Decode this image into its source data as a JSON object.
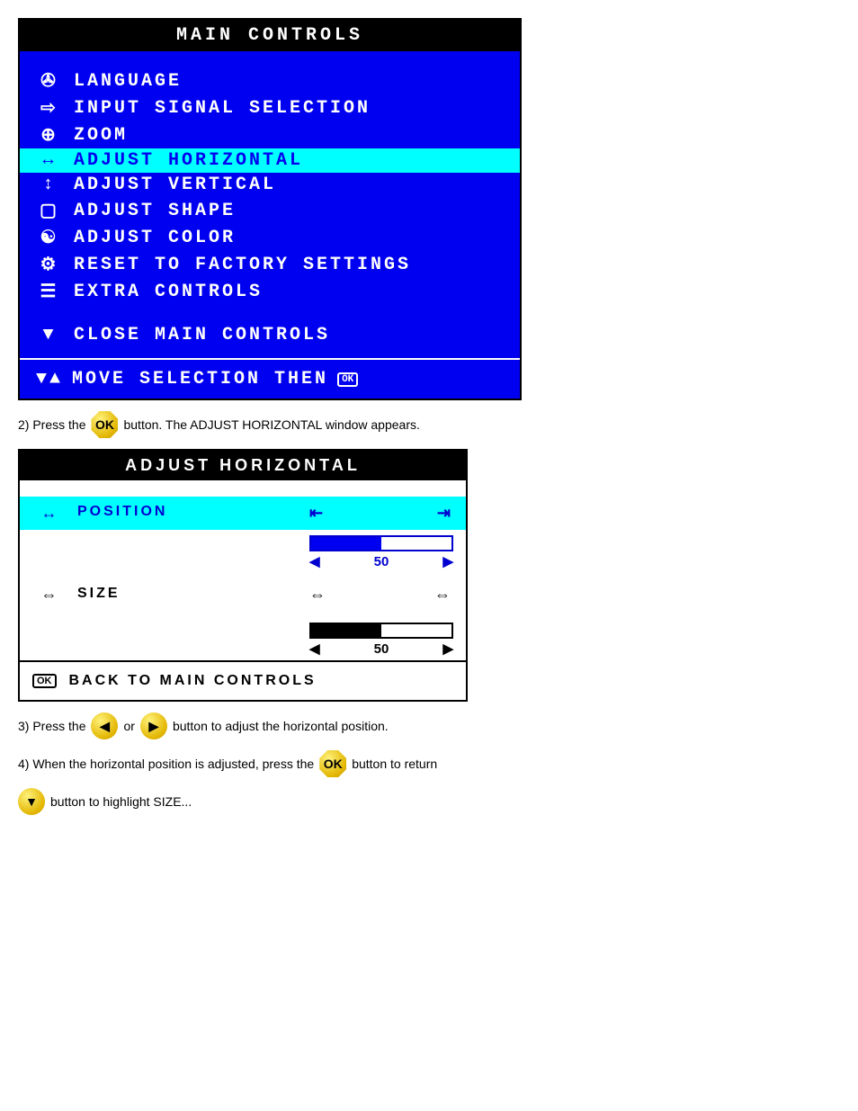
{
  "main_osd": {
    "title": "MAIN CONTROLS",
    "items": [
      {
        "icon": "language-icon",
        "glyph": "✇",
        "label": "LANGUAGE"
      },
      {
        "icon": "input-icon",
        "glyph": "⇨",
        "label": "INPUT SIGNAL SELECTION"
      },
      {
        "icon": "zoom-icon",
        "glyph": "⊕",
        "label": "ZOOM"
      },
      {
        "icon": "horiz-icon",
        "glyph": "↔",
        "label": "ADJUST HORIZONTAL"
      },
      {
        "icon": "vert-icon",
        "glyph": "↕",
        "label": "ADJUST VERTICAL"
      },
      {
        "icon": "shape-icon",
        "glyph": "▢",
        "label": "ADJUST SHAPE"
      },
      {
        "icon": "color-icon",
        "glyph": "☯",
        "label": "ADJUST COLOR"
      },
      {
        "icon": "factory-icon",
        "glyph": "⚙",
        "label": "RESET TO FACTORY SETTINGS"
      },
      {
        "icon": "extra-icon",
        "glyph": "☰",
        "label": "EXTRA CONTROLS"
      }
    ],
    "highlight_index": 3,
    "close": {
      "icon": "down-triangle-icon",
      "glyph": "▼",
      "label": "CLOSE MAIN CONTROLS"
    },
    "footer": {
      "left_icon": "updown-icon",
      "left_glyph": "▼▲",
      "text": "MOVE SELECTION THEN",
      "right_icon": "ok-icon",
      "right_glyph": "OK"
    }
  },
  "step2": {
    "prefix": "2) Press the ",
    "button": "OK",
    "suffix": " button. The ADJUST HORIZONTAL window appears."
  },
  "adjust_panel": {
    "title": "ADJUST HORIZONTAL",
    "rows": [
      {
        "icon": "position-icon",
        "glyph": "↔",
        "label": "POSITION",
        "left_glyph": "⇤",
        "right_glyph": "⇥",
        "value": 50,
        "highlight": true,
        "color": "blue"
      },
      {
        "icon": "size-icon",
        "glyph": "⇔",
        "label": "SIZE",
        "left_glyph": "⇔",
        "right_glyph": "⇔",
        "value": 50,
        "highlight": false,
        "color": "black"
      }
    ],
    "back": {
      "icon": "ok-icon",
      "glyph": "OK",
      "label": "BACK TO MAIN CONTROLS"
    }
  },
  "step3": {
    "prefix": "3) Press the ",
    "b1": "◀",
    "mid": " or ",
    "b2": "▶",
    "suffix": " button to adjust the horizontal position."
  },
  "step4": {
    "prefix": "4) When the horizontal position is adjusted, press the ",
    "button": "OK",
    "suffix": " button to return"
  },
  "step5": {
    "icon": "▼",
    "text": " button to highlight SIZE..."
  }
}
